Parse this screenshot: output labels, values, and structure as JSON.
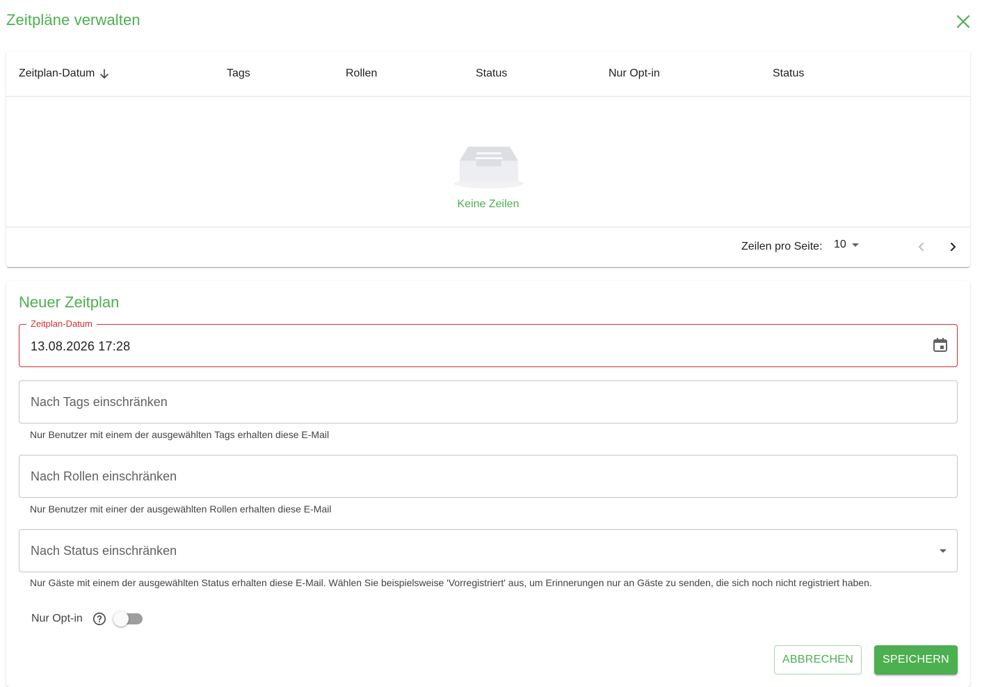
{
  "dialog": {
    "title": "Zeitpläne verwalten",
    "close_icon": "close-icon"
  },
  "table": {
    "columns": [
      {
        "label": "Zeitplan-Datum",
        "sort_icon": "arrow-down-icon"
      },
      {
        "label": "Tags"
      },
      {
        "label": "Rollen"
      },
      {
        "label": "Status"
      },
      {
        "label": "Nur Opt-in"
      },
      {
        "label": "Status"
      }
    ],
    "empty_icon": "empty-inbox-icon",
    "empty_text": "Keine Zeilen",
    "pagination": {
      "rows_per_page_label": "Zeilen pro Seite:",
      "rows_per_page_value": "10",
      "prev_icon": "chevron-left-icon",
      "next_icon": "chevron-right-icon"
    }
  },
  "form": {
    "title": "Neuer Zeitplan",
    "date_field": {
      "label": "Zeitplan-Datum",
      "value": "13.08.2026 17:28",
      "icon": "calendar-icon"
    },
    "tags_field": {
      "placeholder": "Nach Tags einschränken",
      "helper": "Nur Benutzer mit einem der ausgewählten Tags erhalten diese E-Mail"
    },
    "roles_field": {
      "placeholder": "Nach Rollen einschränken",
      "helper": "Nur Benutzer mit einer der ausgewählten Rollen erhalten diese E-Mail"
    },
    "status_field": {
      "placeholder": "Nach Status einschränken",
      "icon": "caret-down-icon",
      "helper": "Nur Gäste mit einem der ausgewählten Status erhalten diese E-Mail. Wählen Sie beispielsweise 'Vorregistriert' aus, um Erinnerungen nur an Gäste zu senden, die sich noch nicht registriert haben."
    },
    "optin": {
      "label": "Nur Opt-in",
      "help_icon": "help-circle-icon",
      "enabled": false
    },
    "buttons": {
      "cancel": "ABBRECHEN",
      "save": "SPEICHERN"
    }
  },
  "colors": {
    "accent": "#4caf50",
    "error": "#d32f2f",
    "border": "#c4c4c4"
  }
}
